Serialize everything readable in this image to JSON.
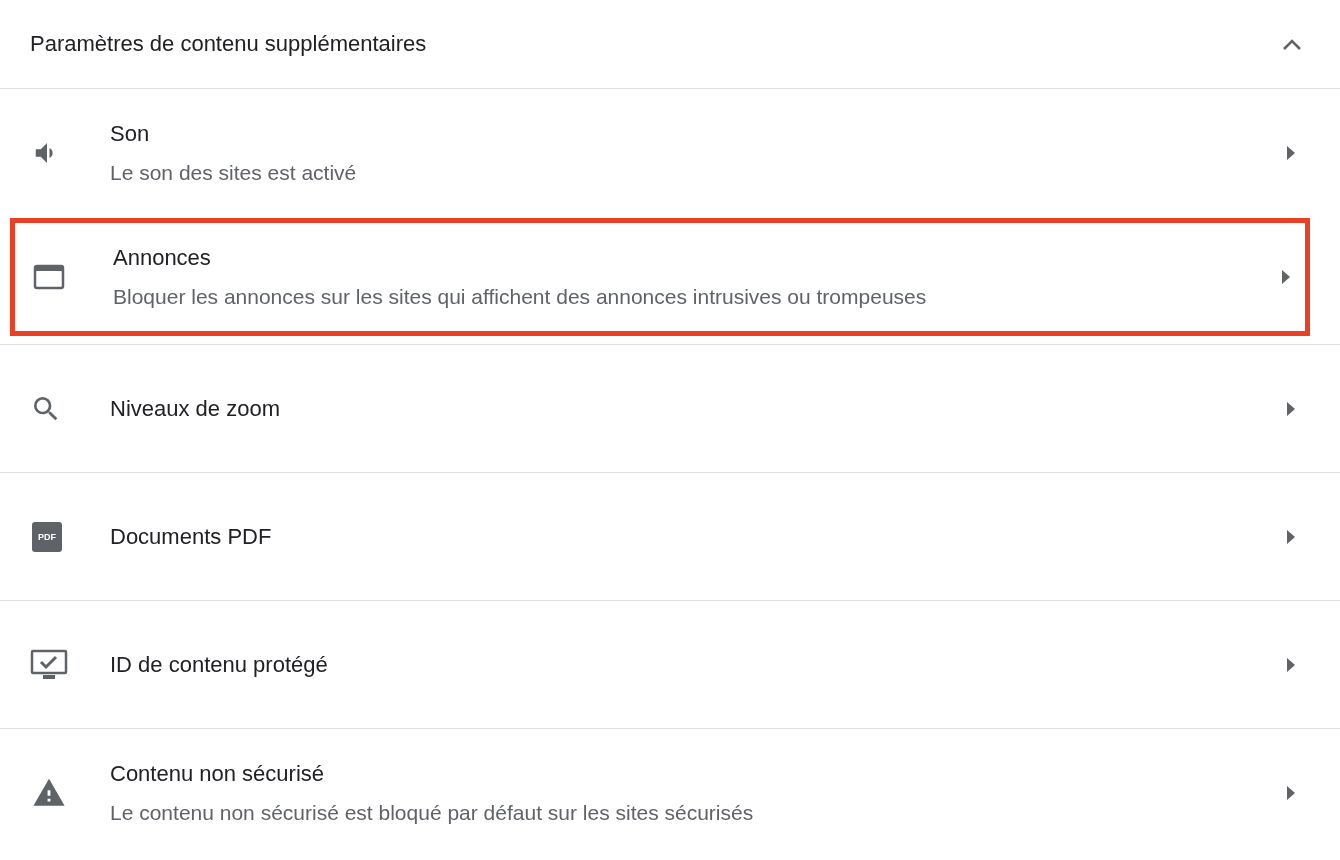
{
  "section": {
    "title": "Paramètres de contenu supplémentaires",
    "expanded": true
  },
  "items": [
    {
      "kind": "sound",
      "title": "Son",
      "subtitle": "Le son des sites est activé",
      "highlighted": false
    },
    {
      "kind": "ads",
      "title": "Annonces",
      "subtitle": "Bloquer les annonces sur les sites qui affichent des annonces intrusives ou trompeuses",
      "highlighted": true
    },
    {
      "kind": "zoom",
      "title": "Niveaux de zoom",
      "highlighted": false
    },
    {
      "kind": "pdf",
      "icon_label": "PDF",
      "title": "Documents PDF",
      "highlighted": false
    },
    {
      "kind": "protected",
      "title": "ID de contenu protégé",
      "highlighted": false
    },
    {
      "kind": "insecure",
      "title": "Contenu non sécurisé",
      "subtitle": "Le contenu non sécurisé est bloqué par défaut sur les sites sécurisés",
      "highlighted": false
    }
  ]
}
